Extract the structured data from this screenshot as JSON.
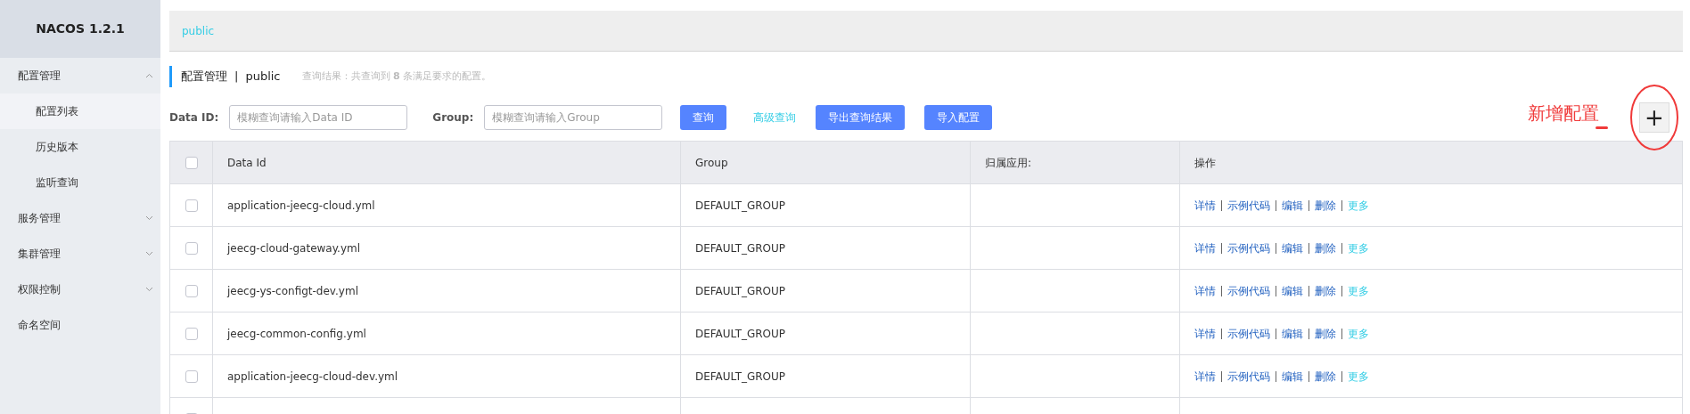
{
  "sidebar": {
    "logo": "NACOS 1.2.1",
    "items": [
      {
        "label": "配置管理",
        "expanded": true,
        "children": [
          {
            "label": "配置列表",
            "selected": true
          },
          {
            "label": "历史版本",
            "selected": false
          },
          {
            "label": "监听查询",
            "selected": false
          }
        ]
      },
      {
        "label": "服务管理",
        "expanded": false
      },
      {
        "label": "集群管理",
        "expanded": false
      },
      {
        "label": "权限控制",
        "expanded": false
      },
      {
        "label": "命名空间"
      }
    ]
  },
  "namespace_bar": {
    "namespace": "public"
  },
  "title": {
    "section": "配置管理",
    "separator": "|",
    "namespace": "public",
    "result": "查询结果：共查询到 **8** 条满足要求的配置。"
  },
  "search": {
    "fields": [
      {
        "label": "Data ID:",
        "placeholder": "模糊查询请输入Data ID"
      },
      {
        "label": "Group:",
        "placeholder": "模糊查询请输入Group"
      }
    ],
    "buttons": [
      {
        "kind": "primary",
        "label": "查询"
      },
      {
        "kind": "link",
        "label": "高级查询"
      },
      {
        "kind": "primary",
        "label": "导出查询结果"
      },
      {
        "kind": "primary",
        "label": "导入配置"
      }
    ]
  },
  "annotation": {
    "text": "新增配置"
  },
  "add_button": {
    "label": "+"
  },
  "table": {
    "all_checked": false,
    "columns": [
      "Data Id",
      "Group",
      "归属应用:",
      "操作"
    ],
    "rows": [
      {
        "checked": false,
        "data_id": "application-jeecg-cloud.yml",
        "group": "DEFAULT_GROUP",
        "actions": [
          {
            "label": "详情",
            "kind": "link"
          },
          {
            "label": "示例代码",
            "kind": "link"
          },
          {
            "label": "编辑",
            "kind": "link"
          },
          {
            "label": "删除",
            "kind": "link"
          },
          {
            "label": "更多",
            "kind": "more"
          }
        ]
      },
      {
        "checked": false,
        "data_id": "jeecg-cloud-gateway.yml",
        "group": "DEFAULT_GROUP",
        "actions": [
          {
            "label": "详情",
            "kind": "link"
          },
          {
            "label": "示例代码",
            "kind": "link"
          },
          {
            "label": "编辑",
            "kind": "link"
          },
          {
            "label": "删除",
            "kind": "link"
          },
          {
            "label": "更多",
            "kind": "more"
          }
        ]
      },
      {
        "checked": false,
        "data_id": "jeecg-ys-configt-dev.yml",
        "group": "DEFAULT_GROUP",
        "actions": [
          {
            "label": "详情",
            "kind": "link"
          },
          {
            "label": "示例代码",
            "kind": "link"
          },
          {
            "label": "编辑",
            "kind": "link"
          },
          {
            "label": "删除",
            "kind": "link"
          },
          {
            "label": "更多",
            "kind": "more"
          }
        ]
      },
      {
        "checked": false,
        "data_id": "jeecg-common-config.yml",
        "group": "DEFAULT_GROUP",
        "actions": [
          {
            "label": "详情",
            "kind": "link"
          },
          {
            "label": "示例代码",
            "kind": "link"
          },
          {
            "label": "编辑",
            "kind": "link"
          },
          {
            "label": "删除",
            "kind": "link"
          },
          {
            "label": "更多",
            "kind": "more"
          }
        ]
      },
      {
        "checked": false,
        "data_id": "application-jeecg-cloud-dev.yml",
        "group": "DEFAULT_GROUP",
        "actions": [
          {
            "label": "详情",
            "kind": "link"
          },
          {
            "label": "示例代码",
            "kind": "link"
          },
          {
            "label": "编辑",
            "kind": "link"
          },
          {
            "label": "删除",
            "kind": "link"
          },
          {
            "label": "更多",
            "kind": "more"
          }
        ]
      },
      {
        "checked": false
      }
    ]
  }
}
